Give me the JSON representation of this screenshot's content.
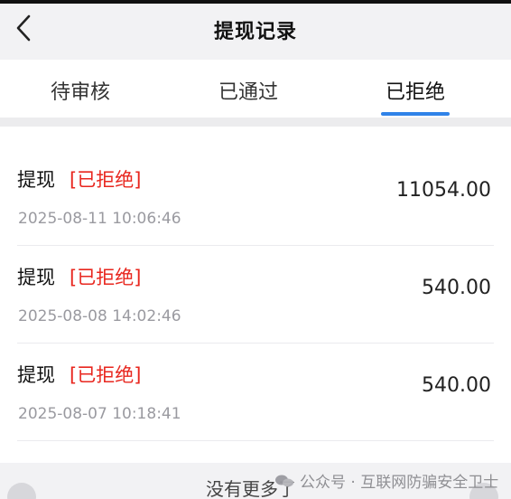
{
  "header": {
    "title": "提现记录"
  },
  "tabs": [
    {
      "label": "待审核"
    },
    {
      "label": "已通过"
    },
    {
      "label": "已拒绝"
    }
  ],
  "active_tab_index": 2,
  "records": [
    {
      "type": "提现",
      "status": "[已拒绝]",
      "date": "2025-08-11 10:06:46",
      "amount": "11054.00"
    },
    {
      "type": "提现",
      "status": "[已拒绝]",
      "date": "2025-08-08 14:02:46",
      "amount": "540.00"
    },
    {
      "type": "提现",
      "status": "[已拒绝]",
      "date": "2025-08-07 10:18:41",
      "amount": "540.00"
    }
  ],
  "footer": {
    "no_more": "没有更多了"
  },
  "watermark": {
    "text": "公众号 · 互联网防骗安全卫士"
  },
  "colors": {
    "accent": "#2f82e8",
    "status_rejected": "#e8261e"
  }
}
